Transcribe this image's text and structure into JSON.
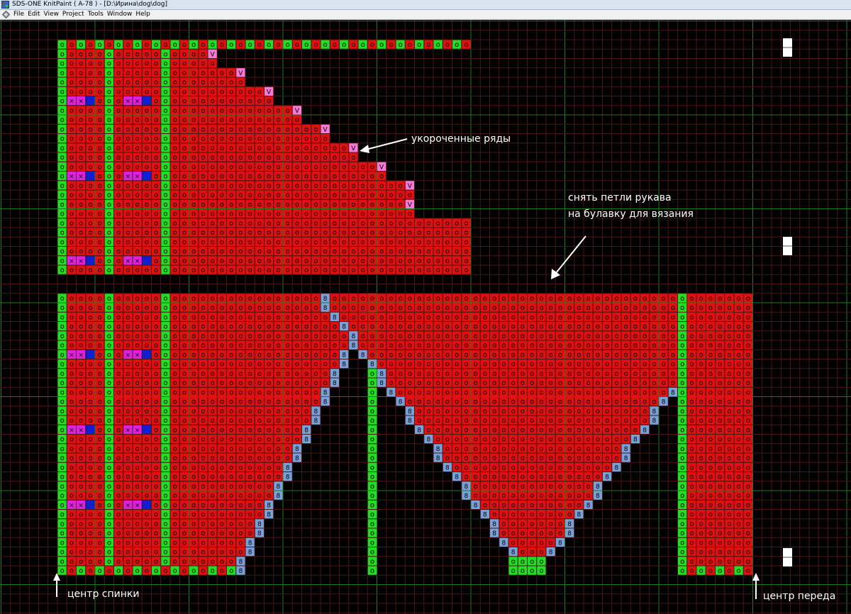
{
  "window": {
    "title": "SDS-ONE KnitPaint ( A-78  ) - [D:\\Ирина\\dog\\dog]",
    "app_icon": "knitpaint-app-icon",
    "doc_icon": "diamond-doc-icon"
  },
  "menu": [
    "File",
    "Edit",
    "View",
    "Project",
    "Tools",
    "Window",
    "Help"
  ],
  "annotations": {
    "short_rows": "укороченные ряды",
    "sleeve_line1": "снять петли рукава",
    "sleeve_line2": "на булавку для вязания",
    "back_center": "центр спинки",
    "front_center": "центр переда"
  },
  "stitch_symbols": {
    "knit": "o",
    "cross": "×",
    "short_row": "V",
    "decrease": "8"
  },
  "colors": {
    "background": "#000000",
    "grid_minor": "#4a1616",
    "grid_major": "#1f7a1f",
    "knit_red": "#e01010",
    "rib_green": "#22dd22",
    "cable_magenta": "#e020e0",
    "cable_blue": "#1020d0",
    "short_row_pink": "#f57ad8",
    "decrease_blue": "#7aa0d8"
  }
}
